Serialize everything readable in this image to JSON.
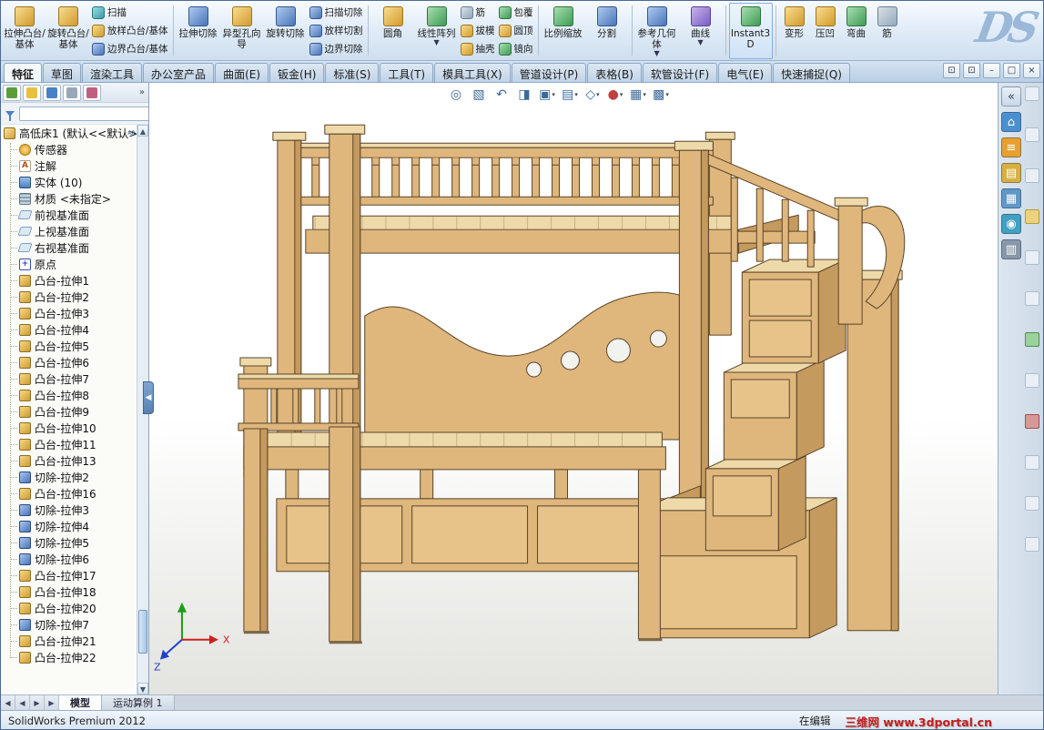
{
  "logo": "DS",
  "ribbon": {
    "extruded_boss": "拉伸凸台/基体",
    "revolved_boss": "旋转凸台/基体",
    "sweep": "扫描",
    "loft": "放样凸台/基体",
    "boundary": "边界凸台/基体",
    "extruded_cut": "拉伸切除",
    "hole_wizard": "异型孔向导",
    "revolved_cut": "旋转切除",
    "swept_cut": "扫描切除",
    "lofted_cut": "放样切割",
    "boundary_cut": "边界切除",
    "fillet": "圆角",
    "linear_pattern": "线性阵列",
    "rib": "筋",
    "draft": "拔模",
    "shell": "抽壳",
    "wrap": "包覆",
    "dome": "圆顶",
    "mirror": "镜向",
    "scale": "比例缩放",
    "split": "分割",
    "reference_geometry": "参考几何体",
    "curves": "曲线",
    "instant3d": "Instant3D",
    "deform": "变形",
    "indent": "压凹",
    "flex": "弯曲",
    "rib2": "筋"
  },
  "tabs": {
    "items": [
      {
        "label": "特征"
      },
      {
        "label": "草图"
      },
      {
        "label": "渲染工具"
      },
      {
        "label": "办公室产品"
      },
      {
        "label": "曲面(E)"
      },
      {
        "label": "钣金(H)"
      },
      {
        "label": "标准(S)"
      },
      {
        "label": "工具(T)"
      },
      {
        "label": "模具工具(X)"
      },
      {
        "label": "管道设计(P)"
      },
      {
        "label": "表格(B)"
      },
      {
        "label": "软管设计(F)"
      },
      {
        "label": "电气(E)"
      },
      {
        "label": "快速捕捉(Q)"
      }
    ]
  },
  "tree": {
    "part_name": "高低床1 (默认<<默认>",
    "filter": {
      "value": "",
      "placeholder": ""
    },
    "folders": [
      {
        "label": "传感器"
      },
      {
        "label": "注解"
      },
      {
        "label": "实体 (10)"
      },
      {
        "label": "材质 <未指定>"
      },
      {
        "label": "前视基准面"
      },
      {
        "label": "上视基准面"
      },
      {
        "label": "右视基准面"
      },
      {
        "label": "原点"
      }
    ],
    "features": [
      {
        "label": "凸台-拉伸1",
        "type": "boss"
      },
      {
        "label": "凸台-拉伸2",
        "type": "boss"
      },
      {
        "label": "凸台-拉伸3",
        "type": "boss"
      },
      {
        "label": "凸台-拉伸4",
        "type": "boss"
      },
      {
        "label": "凸台-拉伸5",
        "type": "boss"
      },
      {
        "label": "凸台-拉伸6",
        "type": "boss"
      },
      {
        "label": "凸台-拉伸7",
        "type": "boss"
      },
      {
        "label": "凸台-拉伸8",
        "type": "boss"
      },
      {
        "label": "凸台-拉伸9",
        "type": "boss"
      },
      {
        "label": "凸台-拉伸10",
        "type": "boss"
      },
      {
        "label": "凸台-拉伸11",
        "type": "boss"
      },
      {
        "label": "凸台-拉伸13",
        "type": "boss"
      },
      {
        "label": "切除-拉伸2",
        "type": "cut"
      },
      {
        "label": "凸台-拉伸16",
        "type": "boss"
      },
      {
        "label": "切除-拉伸3",
        "type": "cut"
      },
      {
        "label": "切除-拉伸4",
        "type": "cut"
      },
      {
        "label": "切除-拉伸5",
        "type": "cut"
      },
      {
        "label": "切除-拉伸6",
        "type": "cut"
      },
      {
        "label": "凸台-拉伸17",
        "type": "boss"
      },
      {
        "label": "凸台-拉伸18",
        "type": "boss"
      },
      {
        "label": "凸台-拉伸20",
        "type": "boss"
      },
      {
        "label": "切除-拉伸7",
        "type": "cut"
      },
      {
        "label": "凸台-拉伸21",
        "type": "boss"
      },
      {
        "label": "凸台-拉伸22",
        "type": "boss"
      }
    ]
  },
  "viewport": {
    "triad": {
      "x": "X",
      "z": "Z"
    }
  },
  "bottom_tabs": {
    "model": "模型",
    "motion": "运动算例 1"
  },
  "status": {
    "left": "SolidWorks Premium 2012",
    "editing": "在编辑",
    "watermark": "三维网 www.3dportal.cn"
  }
}
